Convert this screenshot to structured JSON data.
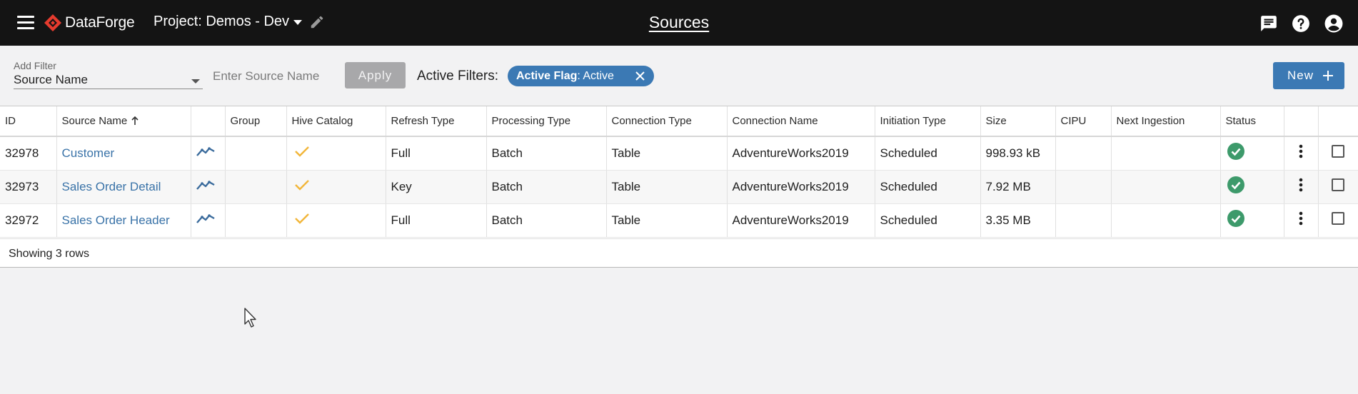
{
  "app": {
    "brand": "DataForge",
    "project": "Project: Demos - Dev",
    "page_title": "Sources"
  },
  "filters": {
    "add_filter_label": "Add Filter",
    "selected_filter": "Source Name",
    "source_name_placeholder": "Enter Source Name",
    "apply_label": "Apply",
    "active_filters_label": "Active Filters:",
    "chip_key": "Active Flag",
    "chip_value": ": Active"
  },
  "actions": {
    "new_label": "New"
  },
  "table": {
    "headers": [
      "ID",
      "Source Name",
      "",
      "Group",
      "Hive Catalog",
      "Refresh Type",
      "Processing Type",
      "Connection Type",
      "Connection Name",
      "Initiation Type",
      "Size",
      "CIPU",
      "Next Ingestion",
      "Status",
      "",
      ""
    ],
    "rows": [
      {
        "id": "32978",
        "source_name": "Customer",
        "group": "",
        "hive_catalog": true,
        "refresh_type": "Full",
        "processing_type": "Batch",
        "connection_type": "Table",
        "connection_name": "AdventureWorks2019",
        "initiation_type": "Scheduled",
        "size": "998.93 kB",
        "cipu": "",
        "next_ingestion": "",
        "status": "success"
      },
      {
        "id": "32973",
        "source_name": "Sales Order Detail",
        "group": "",
        "hive_catalog": true,
        "refresh_type": "Key",
        "processing_type": "Batch",
        "connection_type": "Table",
        "connection_name": "AdventureWorks2019",
        "initiation_type": "Scheduled",
        "size": "7.92 MB",
        "cipu": "",
        "next_ingestion": "",
        "status": "success"
      },
      {
        "id": "32972",
        "source_name": "Sales Order Header",
        "group": "",
        "hive_catalog": true,
        "refresh_type": "Full",
        "processing_type": "Batch",
        "connection_type": "Table",
        "connection_name": "AdventureWorks2019",
        "initiation_type": "Scheduled",
        "size": "3.35 MB",
        "cipu": "",
        "next_ingestion": "",
        "status": "success"
      }
    ],
    "footer": "Showing 3 rows"
  },
  "colors": {
    "topbar": "#141414",
    "accent": "#3b79b4",
    "link": "#3a73a8",
    "check": "#f2b63a",
    "status_ok": "#3d9a6b",
    "brand_red": "#e63b2e"
  },
  "icons": [
    "menu-icon",
    "dataforge-logo-icon",
    "chevron-down-icon",
    "pencil-icon",
    "chat-icon",
    "help-icon",
    "account-icon",
    "close-icon",
    "plus-icon",
    "sort-arrow-up-icon",
    "trend-chart-icon",
    "checkmark-icon",
    "status-success-icon",
    "more-vert-icon",
    "checkbox-icon",
    "mouse-cursor-icon"
  ]
}
